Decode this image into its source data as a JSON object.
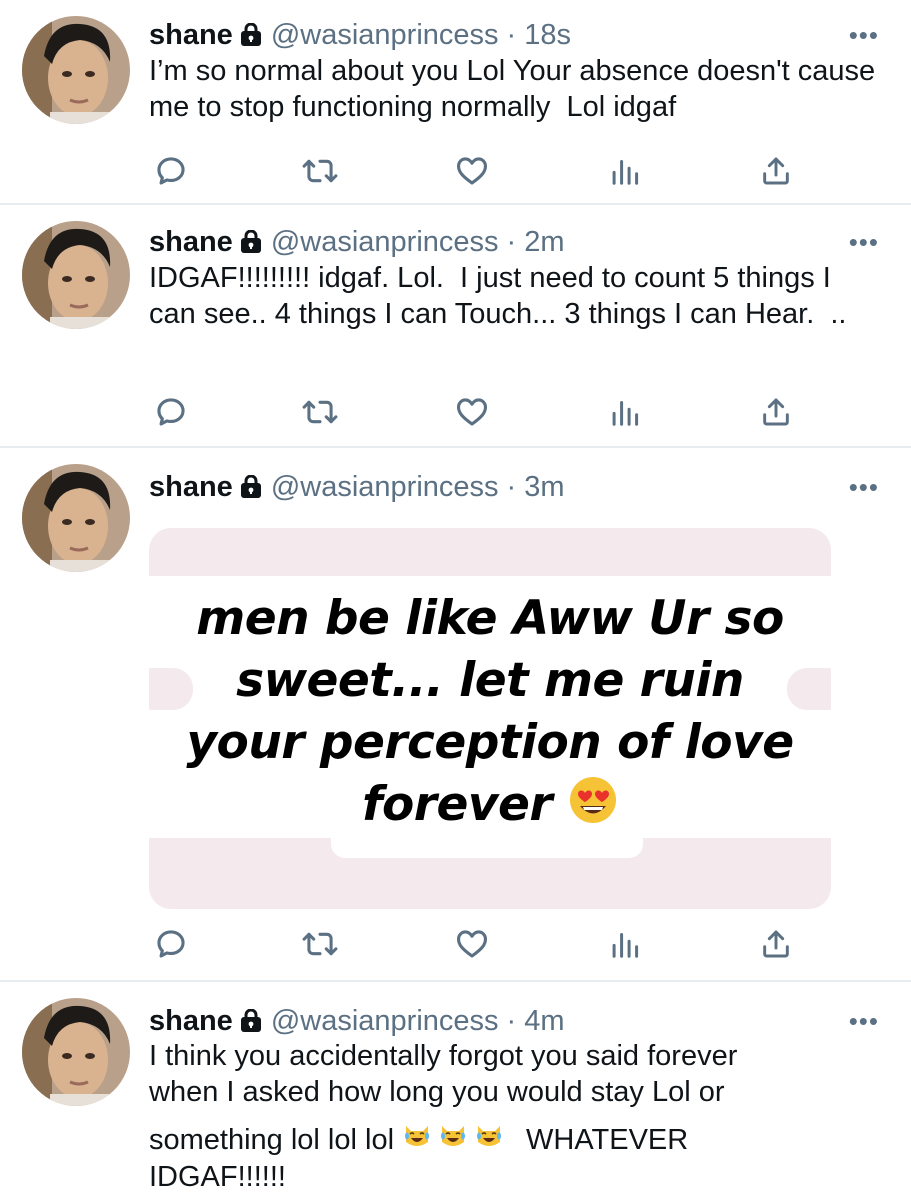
{
  "tweets": [
    {
      "name": "shane",
      "handle": "@wasianprincess",
      "sep": "·",
      "time": "18s",
      "text": "I’m so normal about you Lol Your absence doesn't cause me to stop functioning normally  Lol idgaf",
      "more": "•••"
    },
    {
      "name": "shane",
      "handle": "@wasianprincess",
      "sep": "·",
      "time": "2m",
      "text": "IDGAF!!!!!!!!! idgaf. Lol.  I just need to count 5 things I can see.. 4 things I can Touch... 3 things I can Hear.  ..",
      "more": "•••"
    },
    {
      "name": "shane",
      "handle": "@wasianprincess",
      "sep": "·",
      "time": "3m",
      "more": "•••",
      "media": {
        "line1": "men be like Aww Ur so",
        "line2": "sweet... let me ruin",
        "line3": "your perception of love",
        "line4": "forever",
        "emoji": "heart-eyes-emoji"
      }
    },
    {
      "name": "shane",
      "handle": "@wasianprincess",
      "sep": "·",
      "time": "4m",
      "more": "•••",
      "line1": "I think you accidentally forgot you said forever",
      "line2": "when I asked how long you would stay Lol or",
      "line3a": "something lol lol lol",
      "line3b": "WHATEVER",
      "line4": "IDGAF!!!!!!",
      "emoji": "tears-of-joy-cat-emoji"
    }
  ],
  "colors": {
    "secondary": "#5b7083",
    "divider": "#e6ecf0",
    "media_bg": "#f4e9ec"
  },
  "icons": [
    "reply-icon",
    "retweet-icon",
    "like-icon",
    "analytics-icon",
    "share-icon",
    "lock-icon",
    "more-icon"
  ]
}
